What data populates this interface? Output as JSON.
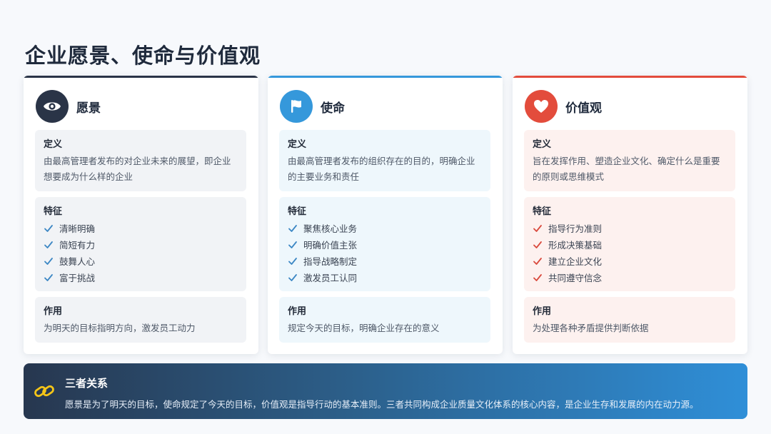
{
  "page": {
    "title": "企业愿景、使命与价值观"
  },
  "cards": [
    {
      "title": "愿景",
      "icon": "eye-icon",
      "accent": "#2a3447",
      "block_bg": "#f1f3f6",
      "check_color": "#3c87c4",
      "definition_label": "定义",
      "definition_text": "由最高管理者发布的对企业未来的展望，即企业想要成为什么样的企业",
      "features_label": "特征",
      "features": [
        "清晰明确",
        "简短有力",
        "鼓舞人心",
        "富于挑战"
      ],
      "role_label": "作用",
      "role_text": "为明天的目标指明方向，激发员工动力"
    },
    {
      "title": "使命",
      "icon": "flag-icon",
      "accent": "#3598db",
      "block_bg": "#eef7fc",
      "check_color": "#3c87c4",
      "definition_label": "定义",
      "definition_text": "由最高管理者发布的组织存在的目的，明确企业的主要业务和责任",
      "features_label": "特征",
      "features": [
        "聚焦核心业务",
        "明确价值主张",
        "指导战略制定",
        "激发员工认同"
      ],
      "role_label": "作用",
      "role_text": "规定今天的目标，明确企业存在的意义"
    },
    {
      "title": "价值观",
      "icon": "heart-icon",
      "accent": "#e34c3c",
      "block_bg": "#fdf1ef",
      "check_color": "#d94a3d",
      "definition_label": "定义",
      "definition_text": "旨在发挥作用、塑造企业文化、确定什么是重要的原则或思维模式",
      "features_label": "特征",
      "features": [
        "指导行为准则",
        "形成决策基础",
        "建立企业文化",
        "共同遵守信念"
      ],
      "role_label": "作用",
      "role_text": "为处理各种矛盾提供判断依据"
    }
  ],
  "relation": {
    "icon": "link-icon",
    "title": "三者关系",
    "text": "愿景是为了明天的目标，使命规定了今天的目标，价值观是指导行动的基本准则。三者共同构成企业质量文化体系的核心内容，是企业生存和发展的内在动力源。"
  }
}
